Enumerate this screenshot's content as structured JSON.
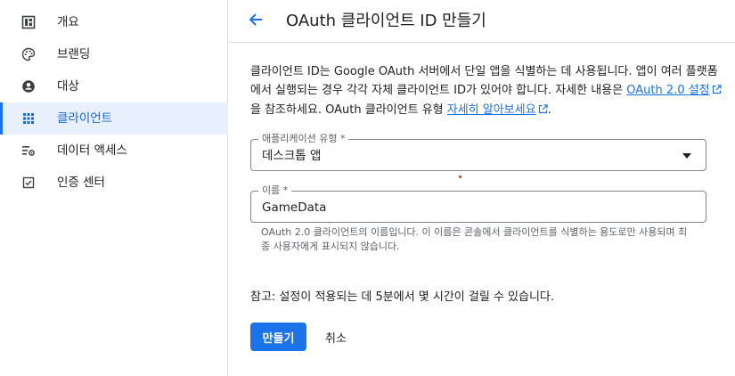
{
  "sidebar": {
    "items": [
      {
        "label": "개요",
        "icon": "dashboard-icon",
        "active": false
      },
      {
        "label": "브랜딩",
        "icon": "palette-icon",
        "active": false
      },
      {
        "label": "대상",
        "icon": "person-icon",
        "active": false
      },
      {
        "label": "클라이언트",
        "icon": "apps-grid-icon",
        "active": true
      },
      {
        "label": "데이터 액세스",
        "icon": "data-settings-icon",
        "active": false
      },
      {
        "label": "인증 센터",
        "icon": "checkbox-icon",
        "active": false
      }
    ]
  },
  "header": {
    "title": "OAuth 클라이언트 ID 만들기"
  },
  "intro": {
    "text1": "클라이언트 ID는 Google OAuth 서버에서 단일 앱을 식별하는 데 사용됩니다. 앱이 여러 플랫폼에서 실행되는 경우 각각 자체 클라이언트 ID가 있어야 합니다. 자세한 내용은 ",
    "link1": "OAuth 2.0 설정",
    "text2": "을 참조하세요. OAuth 클라이언트 유형 ",
    "link2": "자세히 알아보세요",
    "text3": "."
  },
  "form": {
    "app_type_label": "애플리케이션 유형 *",
    "app_type_value": "데스크톱 앱",
    "name_label": "이름 *",
    "name_value": "GameData",
    "name_helper": "OAuth 2.0 클라이언트의 이름입니다. 이 이름은 콘솔에서 클라이언트를 식별하는 용도로만 사용되며 최종 사용자에게 표시되지 않습니다."
  },
  "note": "참고: 설정이 적용되는 데 5분에서 몇 시간이 걸릴 수 있습니다.",
  "actions": {
    "create_label": "만들기",
    "cancel_label": "취소"
  },
  "colors": {
    "accent": "#1a73e8",
    "active_bg": "#e8f0fe",
    "border": "#dadce0",
    "muted_text": "#5f6368"
  }
}
